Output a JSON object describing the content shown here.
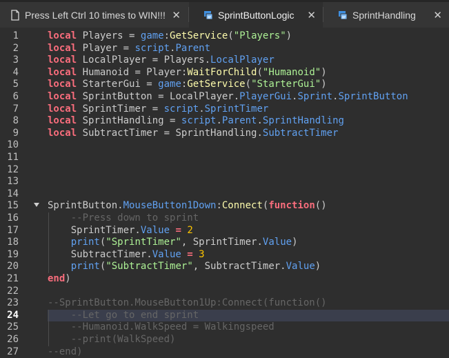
{
  "tabs": [
    {
      "label": "Press Left Ctrl 10 times to WIN!!!",
      "icon": "script-document-icon",
      "active": false
    },
    {
      "label": "SprintButtonLogic",
      "icon": "script-icon",
      "active": true
    },
    {
      "label": "SprintHandling",
      "icon": "script-icon",
      "active": false
    }
  ],
  "close_glyph": "✕",
  "current_line": 24,
  "lines": [
    {
      "n": "1",
      "t": [
        [
          "kw",
          "local"
        ],
        [
          "",
          "Players = "
        ],
        [
          "prop",
          "game"
        ],
        [
          "",
          ":"
        ],
        [
          "fn",
          "GetService"
        ],
        [
          "",
          "("
        ],
        [
          "str",
          "\"Players\""
        ],
        [
          "",
          ")"
        ]
      ]
    },
    {
      "n": "2",
      "t": [
        [
          "kw",
          "local"
        ],
        [
          "",
          "Player = "
        ],
        [
          "prop",
          "script"
        ],
        [
          "",
          "."
        ],
        [
          "prop",
          "Parent"
        ]
      ]
    },
    {
      "n": "3",
      "t": [
        [
          "kw",
          "local"
        ],
        [
          "",
          "LocalPlayer = Players."
        ],
        [
          "prop",
          "LocalPlayer"
        ]
      ]
    },
    {
      "n": "4",
      "t": [
        [
          "kw",
          "local"
        ],
        [
          "",
          "Humanoid = Player:"
        ],
        [
          "fn",
          "WaitForChild"
        ],
        [
          "",
          "("
        ],
        [
          "str",
          "\"Humanoid\""
        ],
        [
          "",
          ")"
        ]
      ]
    },
    {
      "n": "5",
      "t": [
        [
          "kw",
          "local"
        ],
        [
          "",
          "StarterGui = "
        ],
        [
          "prop",
          "game"
        ],
        [
          "",
          ":"
        ],
        [
          "fn",
          "GetService"
        ],
        [
          "",
          "("
        ],
        [
          "str",
          "\"StarterGui\""
        ],
        [
          "",
          ")"
        ]
      ]
    },
    {
      "n": "6",
      "t": [
        [
          "kw",
          "local"
        ],
        [
          "",
          "SprintButton = LocalPlayer."
        ],
        [
          "prop",
          "PlayerGui"
        ],
        [
          "",
          "."
        ],
        [
          "prop",
          "Sprint"
        ],
        [
          "",
          "."
        ],
        [
          "prop",
          "SprintButton"
        ]
      ]
    },
    {
      "n": "7",
      "t": [
        [
          "kw",
          "local"
        ],
        [
          "",
          "SprintTimer = "
        ],
        [
          "prop",
          "script"
        ],
        [
          "",
          "."
        ],
        [
          "prop",
          "SprintTimer"
        ]
      ]
    },
    {
      "n": "8",
      "t": [
        [
          "kw",
          "local"
        ],
        [
          "",
          "SprintHandling = "
        ],
        [
          "prop",
          "script"
        ],
        [
          "",
          "."
        ],
        [
          "prop",
          "Parent"
        ],
        [
          "",
          "."
        ],
        [
          "prop",
          "SprintHandling"
        ]
      ]
    },
    {
      "n": "9",
      "t": [
        [
          "kw",
          "local"
        ],
        [
          "",
          "SubtractTimer = SprintHandling."
        ],
        [
          "prop",
          "SubtractTimer"
        ]
      ]
    },
    {
      "n": "10",
      "t": []
    },
    {
      "n": "11",
      "t": []
    },
    {
      "n": "12",
      "t": []
    },
    {
      "n": "13",
      "t": []
    },
    {
      "n": "14",
      "t": []
    },
    {
      "n": "15",
      "fold": true,
      "t": [
        [
          "",
          "SprintButton."
        ],
        [
          "prop",
          "MouseButton1Down"
        ],
        [
          "",
          ":"
        ],
        [
          "fn",
          "Connect"
        ],
        [
          "",
          "("
        ],
        [
          "kw",
          "function"
        ],
        [
          "",
          "()"
        ]
      ]
    },
    {
      "n": "16",
      "t": [
        [
          "",
          "    "
        ],
        [
          "cmt",
          "--Press down to sprint"
        ]
      ]
    },
    {
      "n": "17",
      "t": [
        [
          "",
          "    SprintTimer."
        ],
        [
          "prop",
          "Value"
        ],
        [
          "",
          ""
        ],
        [
          "kw",
          " = "
        ],
        [
          "num",
          "2"
        ]
      ]
    },
    {
      "n": "18",
      "t": [
        [
          "",
          "    "
        ],
        [
          "prop",
          "print"
        ],
        [
          "",
          "("
        ],
        [
          "str",
          "\"SprintTimer\""
        ],
        [
          "",
          ", SprintTimer."
        ],
        [
          "prop",
          "Value"
        ],
        [
          "",
          ")"
        ]
      ]
    },
    {
      "n": "19",
      "t": [
        [
          "",
          "    SubtractTimer."
        ],
        [
          "prop",
          "Value"
        ],
        [
          "kw",
          " = "
        ],
        [
          "num",
          "3"
        ]
      ]
    },
    {
      "n": "20",
      "t": [
        [
          "",
          "    "
        ],
        [
          "prop",
          "print"
        ],
        [
          "",
          "("
        ],
        [
          "str",
          "\"SubtractTimer\""
        ],
        [
          "",
          ", SubtractTimer."
        ],
        [
          "prop",
          "Value"
        ],
        [
          "",
          ")"
        ]
      ]
    },
    {
      "n": "21",
      "t": [
        [
          "kw",
          "end"
        ],
        [
          "",
          ")"
        ]
      ]
    },
    {
      "n": "22",
      "t": []
    },
    {
      "n": "23",
      "t": [
        [
          "cmt",
          "--SprintButton.MouseButton1Up:Connect(function()"
        ]
      ]
    },
    {
      "n": "24",
      "t": [
        [
          "",
          "    "
        ],
        [
          "cmt",
          "--Let go to end sprint"
        ]
      ]
    },
    {
      "n": "25",
      "t": [
        [
          "",
          "    "
        ],
        [
          "cmt",
          "--Humanoid.WalkSpeed = Walkingspeed"
        ]
      ]
    },
    {
      "n": "26",
      "t": [
        [
          "",
          "    "
        ],
        [
          "cmt",
          "--print(WalkSpeed)"
        ]
      ]
    },
    {
      "n": "27",
      "t": [
        [
          "cmt",
          "--end)"
        ]
      ]
    }
  ]
}
